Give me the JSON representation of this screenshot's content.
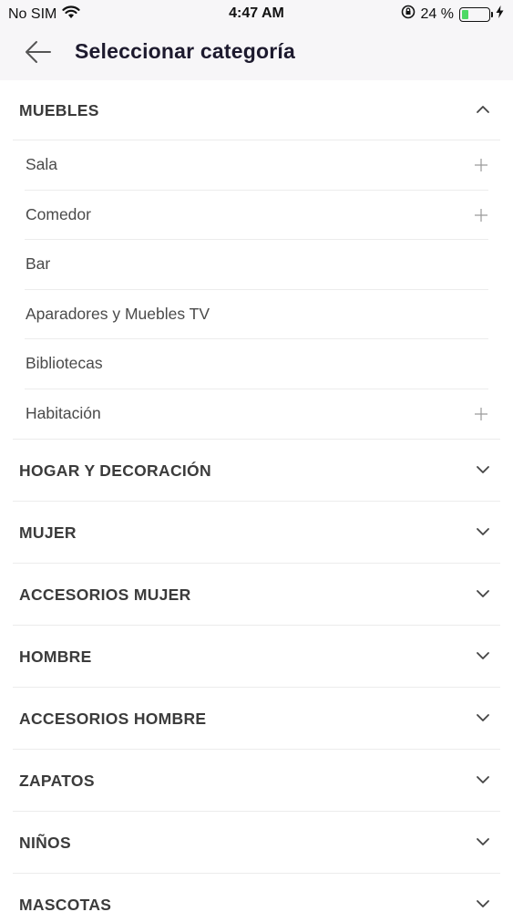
{
  "status_bar": {
    "carrier": "No SIM",
    "time": "4:47 AM",
    "battery_percent": "24 %",
    "battery_level": 0.24,
    "icons": [
      "wifi-icon",
      "orientation-lock-icon",
      "battery-icon",
      "charging-icon"
    ]
  },
  "header": {
    "title": "Seleccionar categoría",
    "back_icon": "arrow-left-icon"
  },
  "categories": [
    {
      "label": "MUEBLES",
      "expanded": true,
      "children": [
        {
          "label": "Sala",
          "has_children": true
        },
        {
          "label": "Comedor",
          "has_children": true
        },
        {
          "label": "Bar",
          "has_children": false
        },
        {
          "label": "Aparadores y Muebles TV",
          "has_children": false
        },
        {
          "label": "Bibliotecas",
          "has_children": false
        },
        {
          "label": "Habitación",
          "has_children": true
        }
      ]
    },
    {
      "label": "HOGAR Y DECORACIÓN",
      "expanded": false
    },
    {
      "label": "MUJER",
      "expanded": false
    },
    {
      "label": "ACCESORIOS MUJER",
      "expanded": false
    },
    {
      "label": "HOMBRE",
      "expanded": false
    },
    {
      "label": "ACCESORIOS HOMBRE",
      "expanded": false
    },
    {
      "label": "ZAPATOS",
      "expanded": false
    },
    {
      "label": "NIÑOS",
      "expanded": false
    },
    {
      "label": "MASCOTAS",
      "expanded": false
    }
  ],
  "colors": {
    "header_bg": "#f7f6f8",
    "title": "#1d1a2e",
    "divider": "#ececec",
    "battery_fill": "#4cd964"
  }
}
